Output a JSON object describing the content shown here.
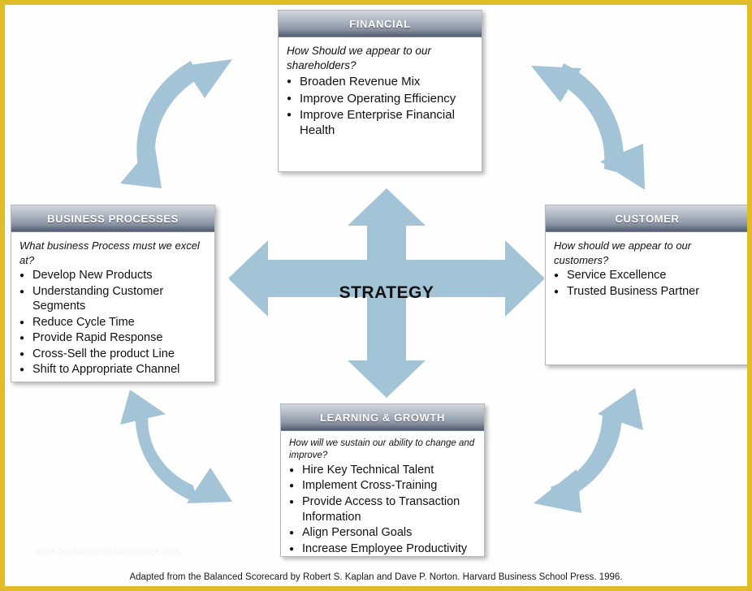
{
  "theme": {
    "border_color": "#e0bc28",
    "arrow_color": "#a3c3d6",
    "header_gradient_top": "#d2d7de",
    "header_gradient_bottom": "#4f5b70",
    "background": "#ffffff"
  },
  "center": {
    "label": "STRATEGY"
  },
  "quadrants": {
    "financial": {
      "title": "FINANCIAL",
      "question": "How Should we appear to our shareholders?",
      "items": [
        "Broaden Revenue Mix",
        "Improve Operating Efficiency",
        "Improve Enterprise Financial Health"
      ]
    },
    "business_processes": {
      "title": "BUSINESS PROCESSES",
      "question": "What business Process must we excel at?",
      "items": [
        "Develop New Products",
        "Understanding Customer Segments",
        "Reduce Cycle Time",
        "Provide Rapid Response",
        "Cross-Sell the product Line",
        "Shift to Appropriate Channel"
      ]
    },
    "customer": {
      "title": "CUSTOMER",
      "question": "How should we appear to our customers?",
      "items": [
        "Service Excellence",
        "Trusted Business Partner"
      ]
    },
    "learning_growth": {
      "title": "LEARNING & GROWTH",
      "question": "How will we sustain our ability to change and improve?",
      "items": [
        "Hire Key Technical Talent",
        "Implement Cross-Training",
        "Provide Access to Transaction Information",
        "Align Personal Goals",
        "Increase Employee Productivity"
      ]
    }
  },
  "arrows": {
    "cross": "four-way-arrow-icon",
    "top_left": "curved-double-arrow-icon",
    "top_right": "curved-double-arrow-icon",
    "bottom_left": "curved-double-arrow-icon",
    "bottom_right": "curved-double-arrow-icon"
  },
  "caption": "Adapted from the Balanced Scorecard by Robert S. Kaplan and Dave P. Norton. Harvard Business School Press. 1996.",
  "watermark": "www.heritagechristiancollege.com"
}
